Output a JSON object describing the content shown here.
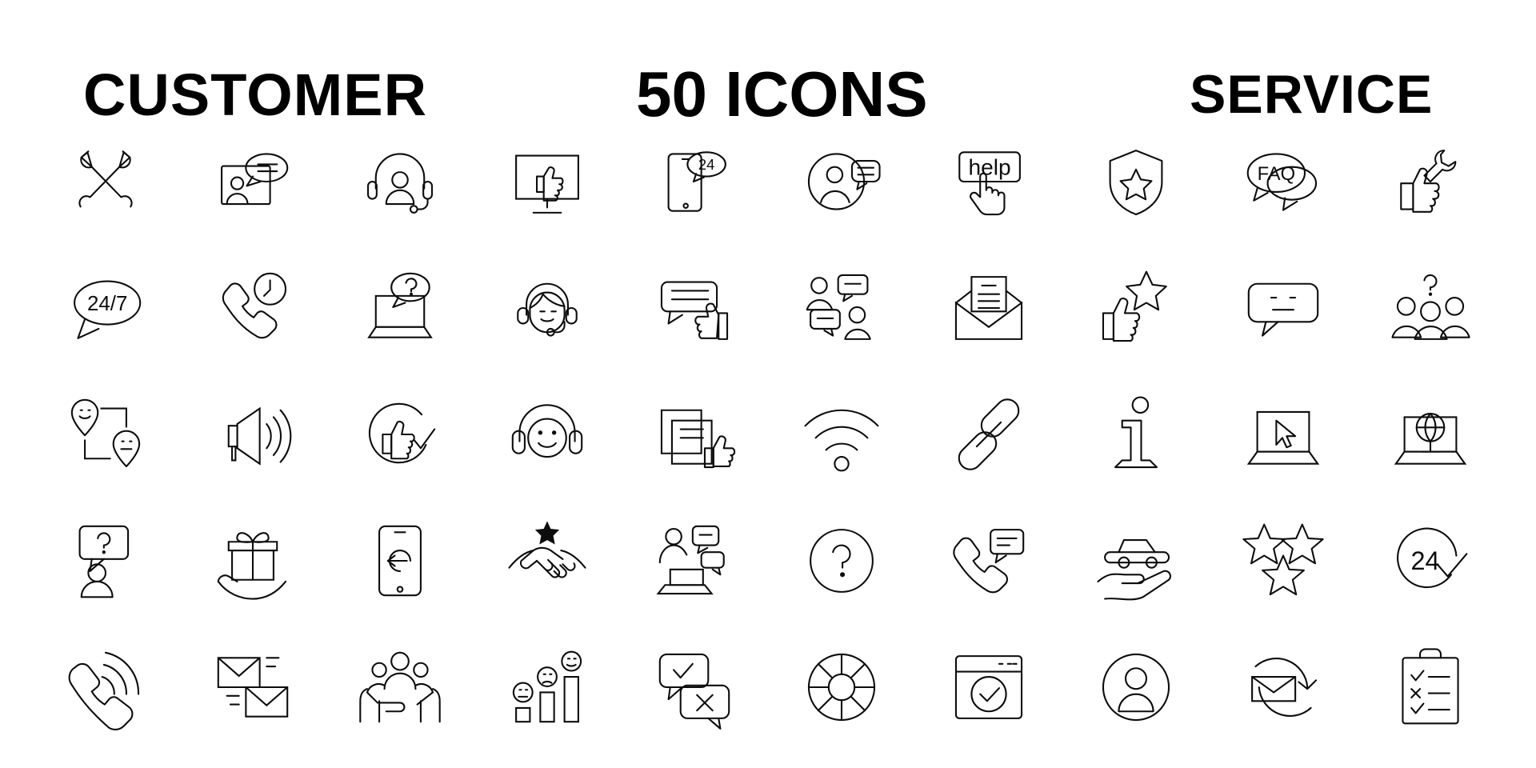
{
  "header": {
    "left_word": "CUSTOMER",
    "center_word": "50 ICONS",
    "right_word": "SERVICE"
  },
  "theme": {
    "background": "#ffffff",
    "stroke": "#0d0d0d"
  },
  "grid": {
    "columns": 10,
    "rows": 5,
    "total_icons": 50
  },
  "inline_labels": {
    "help": "help",
    "faq": "FAQ",
    "twentyfour_seven": "24/7",
    "twentyfour": "24",
    "twentyfour_badge": "24",
    "info": "i"
  },
  "icons": [
    {
      "row": 1,
      "col": 1,
      "name": "crossed-wrenches-icon",
      "label": "Crossed wrenches"
    },
    {
      "row": 1,
      "col": 2,
      "name": "customer-feedback-card-icon",
      "label": "Customer feedback card"
    },
    {
      "row": 1,
      "col": 3,
      "name": "headset-agent-icon",
      "label": "Headset support agent"
    },
    {
      "row": 1,
      "col": 4,
      "name": "monitor-thumbs-up-icon",
      "label": "Monitor with thumbs up"
    },
    {
      "row": 1,
      "col": 5,
      "name": "mobile-24-support-icon",
      "label": "Mobile 24 hour support"
    },
    {
      "row": 1,
      "col": 6,
      "name": "user-chat-bubble-icon",
      "label": "User with chat bubble"
    },
    {
      "row": 1,
      "col": 7,
      "name": "help-button-click-icon",
      "label": "Help button click"
    },
    {
      "row": 1,
      "col": 8,
      "name": "shield-star-icon",
      "label": "Shield with star"
    },
    {
      "row": 1,
      "col": 9,
      "name": "faq-speech-bubbles-icon",
      "label": "FAQ speech bubbles"
    },
    {
      "row": 1,
      "col": 10,
      "name": "thumbs-up-wrench-icon",
      "label": "Thumbs up with wrench"
    },
    {
      "row": 2,
      "col": 1,
      "name": "24-7-bubble-icon",
      "label": "24/7 speech bubble"
    },
    {
      "row": 2,
      "col": 2,
      "name": "phone-clock-icon",
      "label": "Phone with clock"
    },
    {
      "row": 2,
      "col": 3,
      "name": "laptop-question-icon",
      "label": "Laptop with question bubble"
    },
    {
      "row": 2,
      "col": 4,
      "name": "operator-woman-headset-icon",
      "label": "Female operator with headset"
    },
    {
      "row": 2,
      "col": 5,
      "name": "chat-thumbs-up-icon",
      "label": "Chat bubble with thumbs up"
    },
    {
      "row": 2,
      "col": 6,
      "name": "two-users-chat-icon",
      "label": "Two users chatting"
    },
    {
      "row": 2,
      "col": 7,
      "name": "open-envelope-letter-icon",
      "label": "Open envelope with letter"
    },
    {
      "row": 2,
      "col": 8,
      "name": "thumbs-up-star-icon",
      "label": "Thumbs up with star"
    },
    {
      "row": 2,
      "col": 9,
      "name": "neutral-face-bubble-icon",
      "label": "Neutral face speech bubble"
    },
    {
      "row": 2,
      "col": 10,
      "name": "group-question-icon",
      "label": "Group with question mark"
    },
    {
      "row": 3,
      "col": 1,
      "name": "location-feedback-icon",
      "label": "Location pins feedback"
    },
    {
      "row": 3,
      "col": 2,
      "name": "megaphone-icon",
      "label": "Megaphone announcement"
    },
    {
      "row": 3,
      "col": 3,
      "name": "thumbs-up-approved-icon",
      "label": "Approved thumbs up circle"
    },
    {
      "row": 3,
      "col": 4,
      "name": "smiley-headphones-icon",
      "label": "Smiley with headphones"
    },
    {
      "row": 3,
      "col": 5,
      "name": "documents-thumbs-up-icon",
      "label": "Documents with thumbs up"
    },
    {
      "row": 3,
      "col": 6,
      "name": "wifi-signal-icon",
      "label": "Wifi signal"
    },
    {
      "row": 3,
      "col": 7,
      "name": "chain-link-icon",
      "label": "Chain link"
    },
    {
      "row": 3,
      "col": 8,
      "name": "information-icon",
      "label": "Information marker"
    },
    {
      "row": 3,
      "col": 9,
      "name": "laptop-cursor-icon",
      "label": "Laptop with cursor"
    },
    {
      "row": 3,
      "col": 10,
      "name": "laptop-globe-icon",
      "label": "Laptop with globe"
    },
    {
      "row": 4,
      "col": 1,
      "name": "user-question-bubble-icon",
      "label": "User with question bubble"
    },
    {
      "row": 4,
      "col": 2,
      "name": "gift-in-hand-icon",
      "label": "Gift in hand"
    },
    {
      "row": 4,
      "col": 3,
      "name": "mobile-back-arrow-icon",
      "label": "Mobile with back arrow"
    },
    {
      "row": 4,
      "col": 4,
      "name": "handshake-star-icon",
      "label": "Handshake with star"
    },
    {
      "row": 4,
      "col": 5,
      "name": "agent-laptop-chat-icon",
      "label": "Agent at laptop chatting"
    },
    {
      "row": 4,
      "col": 6,
      "name": "question-circle-icon",
      "label": "Question mark circle"
    },
    {
      "row": 4,
      "col": 7,
      "name": "phone-message-icon",
      "label": "Phone with message bubble"
    },
    {
      "row": 4,
      "col": 8,
      "name": "car-in-hand-icon",
      "label": "Car in hand insurance"
    },
    {
      "row": 4,
      "col": 9,
      "name": "three-stars-rating-icon",
      "label": "Three stars rating"
    },
    {
      "row": 4,
      "col": 10,
      "name": "24-hour-check-icon",
      "label": "24 hour check circle"
    },
    {
      "row": 5,
      "col": 1,
      "name": "ringing-phone-icon",
      "label": "Ringing phone handset"
    },
    {
      "row": 5,
      "col": 2,
      "name": "sending-emails-icon",
      "label": "Sending emails"
    },
    {
      "row": 5,
      "col": 3,
      "name": "people-in-hands-icon",
      "label": "People held in hands"
    },
    {
      "row": 5,
      "col": 4,
      "name": "satisfaction-chart-icon",
      "label": "Satisfaction rating chart"
    },
    {
      "row": 5,
      "col": 5,
      "name": "approve-reject-chat-icon",
      "label": "Approve and reject chat"
    },
    {
      "row": 5,
      "col": 6,
      "name": "lifebuoy-icon",
      "label": "Lifebuoy support"
    },
    {
      "row": 5,
      "col": 7,
      "name": "browser-check-icon",
      "label": "Browser window with check"
    },
    {
      "row": 5,
      "col": 8,
      "name": "user-account-circle-icon",
      "label": "User account circle"
    },
    {
      "row": 5,
      "col": 9,
      "name": "email-refresh-icon",
      "label": "Email refresh cycle"
    },
    {
      "row": 5,
      "col": 10,
      "name": "checklist-clipboard-icon",
      "label": "Checklist clipboard"
    }
  ]
}
